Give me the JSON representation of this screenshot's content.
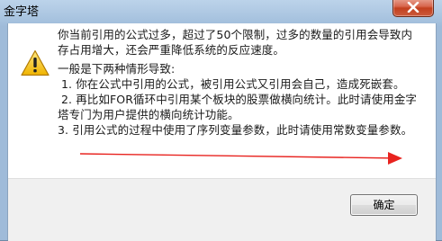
{
  "window": {
    "title": "金字塔"
  },
  "dialog": {
    "intro_line1": "你当前引用的公式过多，超过了50个限制，过多的数量的引用会导致内",
    "intro_line2": "存占用增大，还会严重降低系统的反应速度。",
    "causes_heading": "一般是下两种情形导致:",
    "item1": "1. 你在公式中引用的公式，被引用公式又引用会自己，造成死嵌套。",
    "item2_line1": "2. 再比如FOR循环中引用某个板块的股票做横向统计。此时请使用金字",
    "item2_line2": "塔专门为用户提供的横向统计功能。",
    "item3": "3. 引用公式的过程中使用了序列变量参数，此时请使用常数变量参数。",
    "icon": "warning-icon",
    "annotation_color": "#e8231f"
  },
  "buttons": {
    "ok_label": "确定"
  }
}
